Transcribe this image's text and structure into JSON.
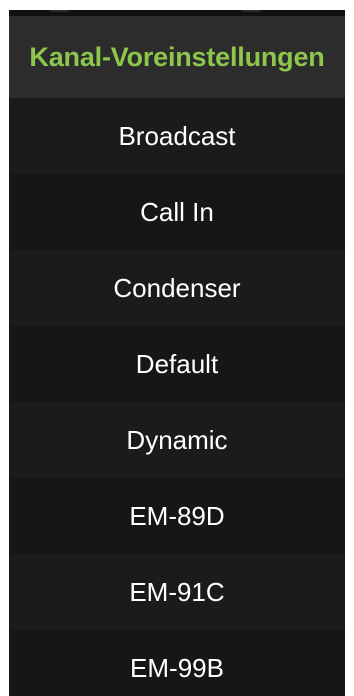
{
  "menu": {
    "title": "Kanal-Voreinstellungen",
    "title_color": "#8cc64a",
    "background": "#1a1a1a",
    "items": [
      {
        "label": "Broadcast"
      },
      {
        "label": "Call In"
      },
      {
        "label": "Condenser"
      },
      {
        "label": "Default"
      },
      {
        "label": "Dynamic"
      },
      {
        "label": "EM-89D"
      },
      {
        "label": "EM-91C"
      },
      {
        "label": "EM-99B"
      }
    ]
  }
}
